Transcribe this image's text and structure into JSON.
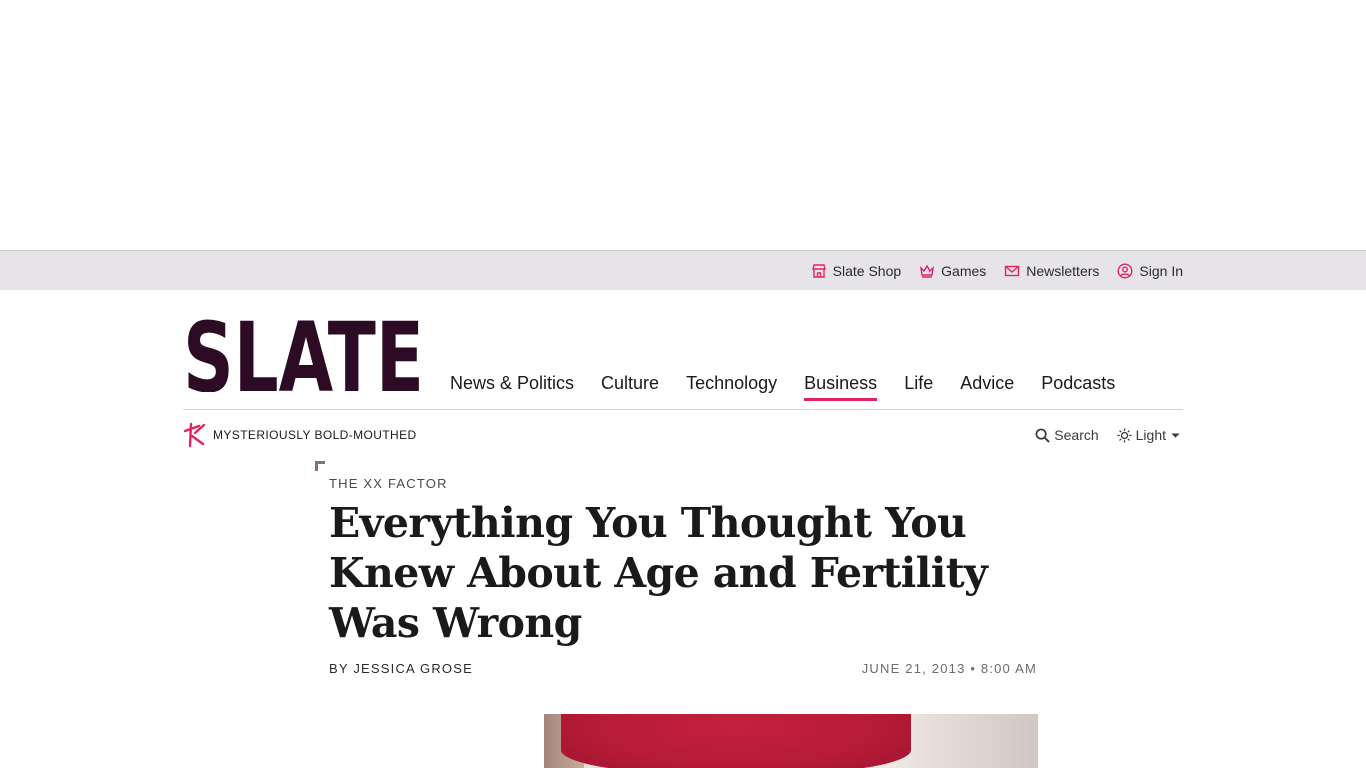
{
  "utility": {
    "links": [
      {
        "label": "Slate Shop",
        "icon": "shop-icon"
      },
      {
        "label": "Games",
        "icon": "crown-icon"
      },
      {
        "label": "Newsletters",
        "icon": "envelope-icon"
      },
      {
        "label": "Sign In",
        "icon": "user-icon"
      }
    ]
  },
  "header": {
    "logo_text": "SLATE",
    "nav": [
      "News & Politics",
      "Culture",
      "Technology",
      "Business",
      "Life",
      "Advice",
      "Podcasts"
    ],
    "active_nav": "Business"
  },
  "subheader": {
    "tagline": "MYSTERIOUSLY BOLD-MOUTHED",
    "search_label": "Search",
    "theme_label": "Light"
  },
  "article": {
    "kicker": "THE XX FACTOR",
    "headline": "Everything You Thought You Knew About Age and Fertility Was Wrong",
    "byline_prefix": "BY",
    "author": "JESSICA GROSE",
    "date": "JUNE 21, 2013",
    "time": "8:00 AM"
  },
  "colors": {
    "accent": "#e3245b",
    "logo": "#2e0b24",
    "utility_bg": "#e6e4e8"
  }
}
